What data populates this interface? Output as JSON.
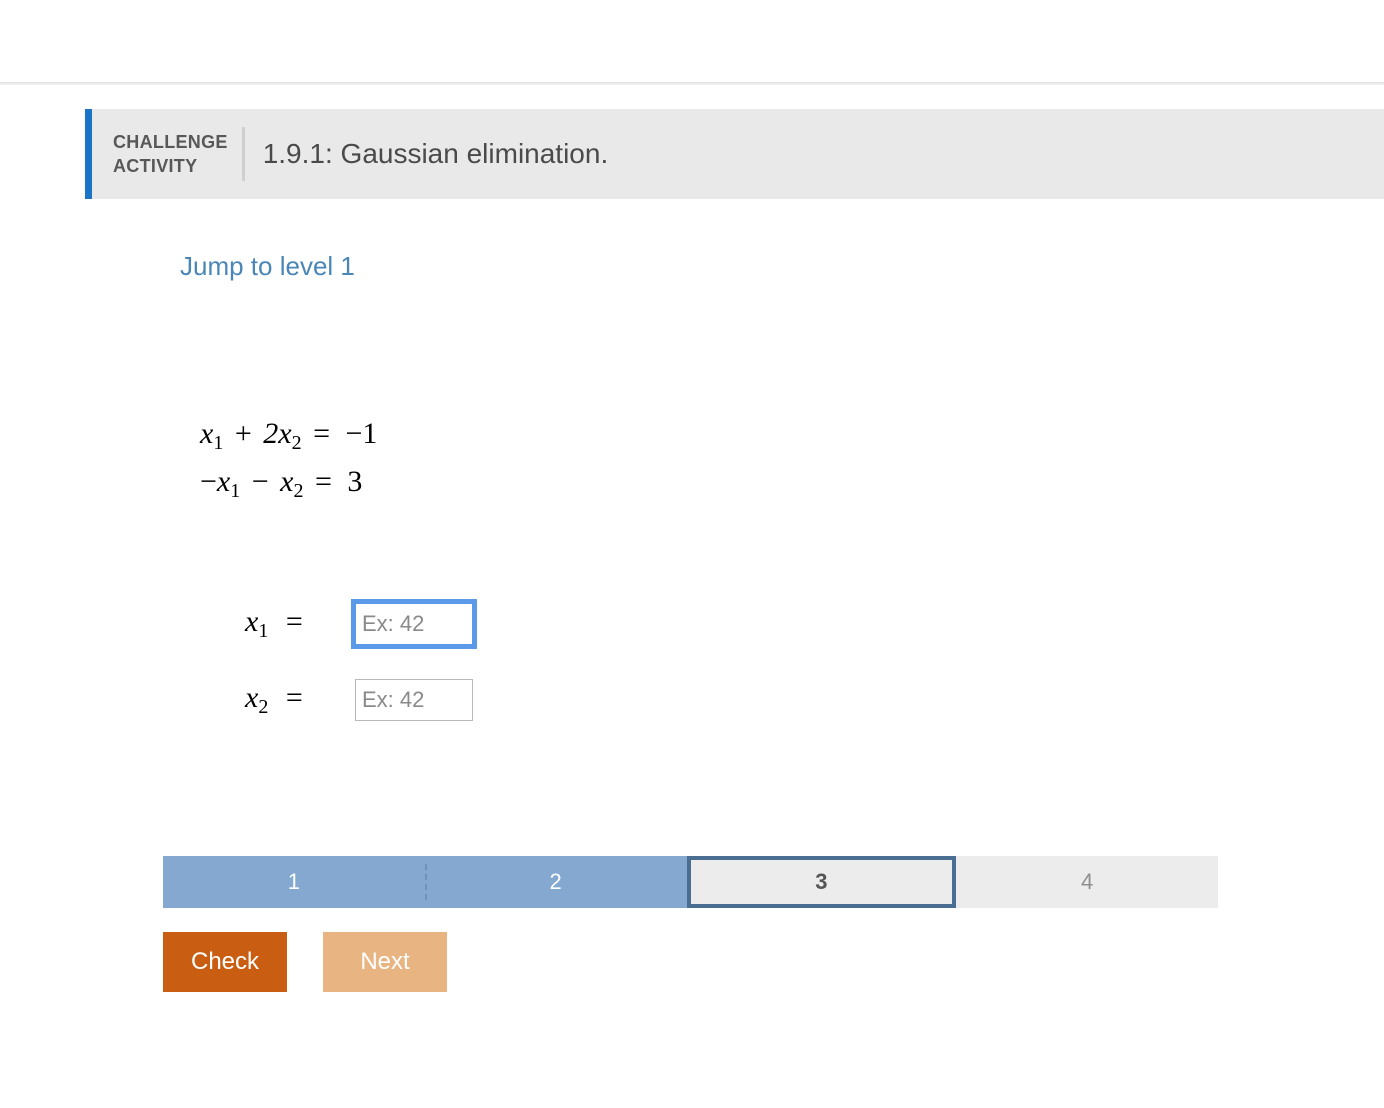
{
  "header": {
    "label_line1": "CHALLENGE",
    "label_line2": "ACTIVITY",
    "title": "1.9.1: Gaussian elimination."
  },
  "jump_link": "Jump to level 1",
  "equations": {
    "eq1": {
      "c1": "",
      "v1": "x",
      "s1": "1",
      "op1": "+",
      "c2": "2",
      "v2": "x",
      "s2": "2",
      "eq": "=",
      "rhs": "−1"
    },
    "eq2": {
      "c1": "−",
      "v1": "x",
      "s1": "1",
      "op1": "−",
      "c2": "",
      "v2": "x",
      "s2": "2",
      "eq": "=",
      "rhs": "3"
    }
  },
  "answers": {
    "x1": {
      "var": "x",
      "sub": "1",
      "eq": "=",
      "placeholder": "Ex: 42",
      "value": ""
    },
    "x2": {
      "var": "x",
      "sub": "2",
      "eq": "=",
      "placeholder": "Ex: 42",
      "value": ""
    }
  },
  "progress": {
    "cells": [
      {
        "label": "1",
        "state": "done"
      },
      {
        "label": "2",
        "state": "done"
      },
      {
        "label": "3",
        "state": "current"
      },
      {
        "label": "4",
        "state": "future"
      }
    ]
  },
  "buttons": {
    "check": "Check",
    "next": "Next"
  }
}
